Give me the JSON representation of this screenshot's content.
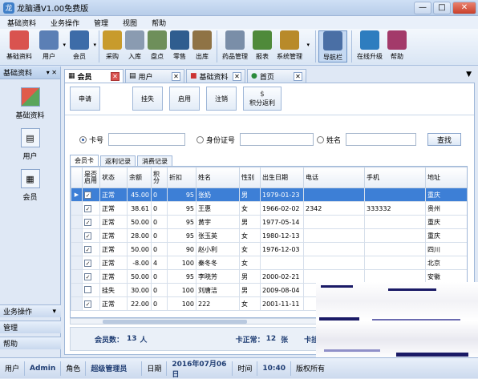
{
  "window": {
    "title": "龙脑通V1.00免费版",
    "min": "—",
    "max": "□",
    "close": "✕"
  },
  "menu": [
    "基础资料",
    "业务操作",
    "管理",
    "视图",
    "帮助"
  ],
  "toolbar": [
    {
      "label": "基础资料",
      "icon": "grid-icon",
      "color": "#d9534f"
    },
    {
      "label": "用户",
      "icon": "user-card-icon",
      "color": "#5b7fb5"
    },
    {
      "label": "会员",
      "icon": "member-card-icon",
      "color": "#3d6ca8"
    },
    {
      "label": "采购",
      "icon": "purchase-icon",
      "color": "#c89b2c"
    },
    {
      "label": "入库",
      "icon": "warehouse-in-icon",
      "color": "#8a9bb1"
    },
    {
      "label": "盘点",
      "icon": "inventory-check-icon",
      "color": "#6e8f5a"
    },
    {
      "label": "零售",
      "icon": "retail-monitor-icon",
      "color": "#2f5d8f"
    },
    {
      "label": "出库",
      "icon": "warehouse-out-icon",
      "color": "#8f7345"
    },
    {
      "label": "药品管理",
      "icon": "medicine-icon",
      "color": "#7a8ea8"
    },
    {
      "label": "报表",
      "icon": "report-icon",
      "color": "#4f8a3a"
    },
    {
      "label": "系统管理",
      "icon": "system-gear-icon",
      "color": "#b88a2a"
    },
    {
      "label": "导航栏",
      "icon": "nav-bar-icon",
      "color": "#4a6fa5"
    },
    {
      "label": "在线升级",
      "icon": "globe-icon",
      "color": "#2e7dbf"
    },
    {
      "label": "帮助",
      "icon": "help-book-icon",
      "color": "#a33a6a"
    }
  ],
  "left_panel": {
    "header": "基础资料",
    "pin": "▾ ✕",
    "items": [
      {
        "label": "基础资料",
        "icon": "grid-icon"
      },
      {
        "label": "用户",
        "icon": "user-card-icon"
      },
      {
        "label": "会员",
        "icon": "member-card-icon"
      }
    ],
    "sections": [
      "业务操作",
      "管理",
      "帮助"
    ]
  },
  "doc_tabs": [
    {
      "label": "会员",
      "active": true
    },
    {
      "label": "用户",
      "active": false
    },
    {
      "label": "基础资料",
      "active": false
    },
    {
      "label": "首页",
      "active": false
    }
  ],
  "actions": [
    {
      "label": "申请",
      "icon": ""
    },
    {
      "label": "挂失",
      "icon": ""
    },
    {
      "label": "启用",
      "icon": ""
    },
    {
      "label": "注销",
      "icon": ""
    },
    {
      "label": "积分返利",
      "icon": "$"
    }
  ],
  "search": {
    "opt_card": "卡号",
    "opt_id": "身份证号",
    "opt_name": "姓名",
    "card_value": "",
    "id_value": "",
    "name_value": "",
    "button": "查找"
  },
  "sub_tabs": [
    "会员卡",
    "返利记录",
    "消费记录"
  ],
  "table": {
    "columns": [
      "是否启用",
      "状态",
      "余额",
      "积分",
      "折扣",
      "姓名",
      "性别",
      "出生日期",
      "电话",
      "手机",
      "地址"
    ],
    "rows": [
      {
        "enabled": true,
        "status": "正常",
        "balance": "45.00",
        "points": "0",
        "discount": "95",
        "name": "张奶",
        "gender": "男",
        "birth": "1979-01-23",
        "phone": "",
        "mobile": "",
        "address": "重庆",
        "selected": true
      },
      {
        "enabled": true,
        "status": "正常",
        "balance": "38.61",
        "points": "0",
        "discount": "95",
        "name": "王惠",
        "gender": "女",
        "birth": "1966-02-02",
        "phone": "2342",
        "mobile": "333332",
        "address": "贵州",
        "selected": false
      },
      {
        "enabled": true,
        "status": "正常",
        "balance": "50.00",
        "points": "0",
        "discount": "95",
        "name": "黄宇",
        "gender": "男",
        "birth": "1977-05-14",
        "phone": "",
        "mobile": "",
        "address": "重庆",
        "selected": false
      },
      {
        "enabled": true,
        "status": "正常",
        "balance": "28.00",
        "points": "0",
        "discount": "95",
        "name": "张玉英",
        "gender": "女",
        "birth": "1980-12-13",
        "phone": "",
        "mobile": "",
        "address": "重庆",
        "selected": false
      },
      {
        "enabled": true,
        "status": "正常",
        "balance": "50.00",
        "points": "0",
        "discount": "90",
        "name": "赵小利",
        "gender": "女",
        "birth": "1976-12-03",
        "phone": "",
        "mobile": "",
        "address": "四川",
        "selected": false
      },
      {
        "enabled": true,
        "status": "正常",
        "balance": "-8.00",
        "points": "4",
        "discount": "100",
        "name": "秦冬冬",
        "gender": "女",
        "birth": "",
        "phone": "",
        "mobile": "",
        "address": "北京",
        "selected": false
      },
      {
        "enabled": true,
        "status": "正常",
        "balance": "50.00",
        "points": "0",
        "discount": "95",
        "name": "李晓芳",
        "gender": "男",
        "birth": "2000-02-21",
        "phone": "",
        "mobile": "",
        "address": "安徽",
        "selected": false
      },
      {
        "enabled": false,
        "status": "挂失",
        "balance": "30.00",
        "points": "0",
        "discount": "100",
        "name": "刘唐洁",
        "gender": "男",
        "birth": "2009-08-04",
        "phone": "",
        "mobile": "",
        "address": "",
        "selected": false
      },
      {
        "enabled": true,
        "status": "正常",
        "balance": "22.00",
        "points": "0",
        "discount": "100",
        "name": "222",
        "gender": "女",
        "birth": "2001-11-11",
        "phone": "",
        "mobile": "",
        "address": "",
        "selected": false
      }
    ]
  },
  "footer": {
    "member_count_label": "会员数：",
    "member_count": "13",
    "member_count_unit": "人",
    "normal_label": "卡正常：",
    "normal_count": "12",
    "normal_unit": "张",
    "lost_label": "卡挂"
  },
  "status": {
    "user_label": "用户",
    "user": "Admin",
    "role_label": "角色",
    "role": "超级管理员",
    "date_label": "日期",
    "date": "2016年07月06日",
    "time_label": "时间",
    "time": "10:40",
    "copyright": "版权所有"
  }
}
